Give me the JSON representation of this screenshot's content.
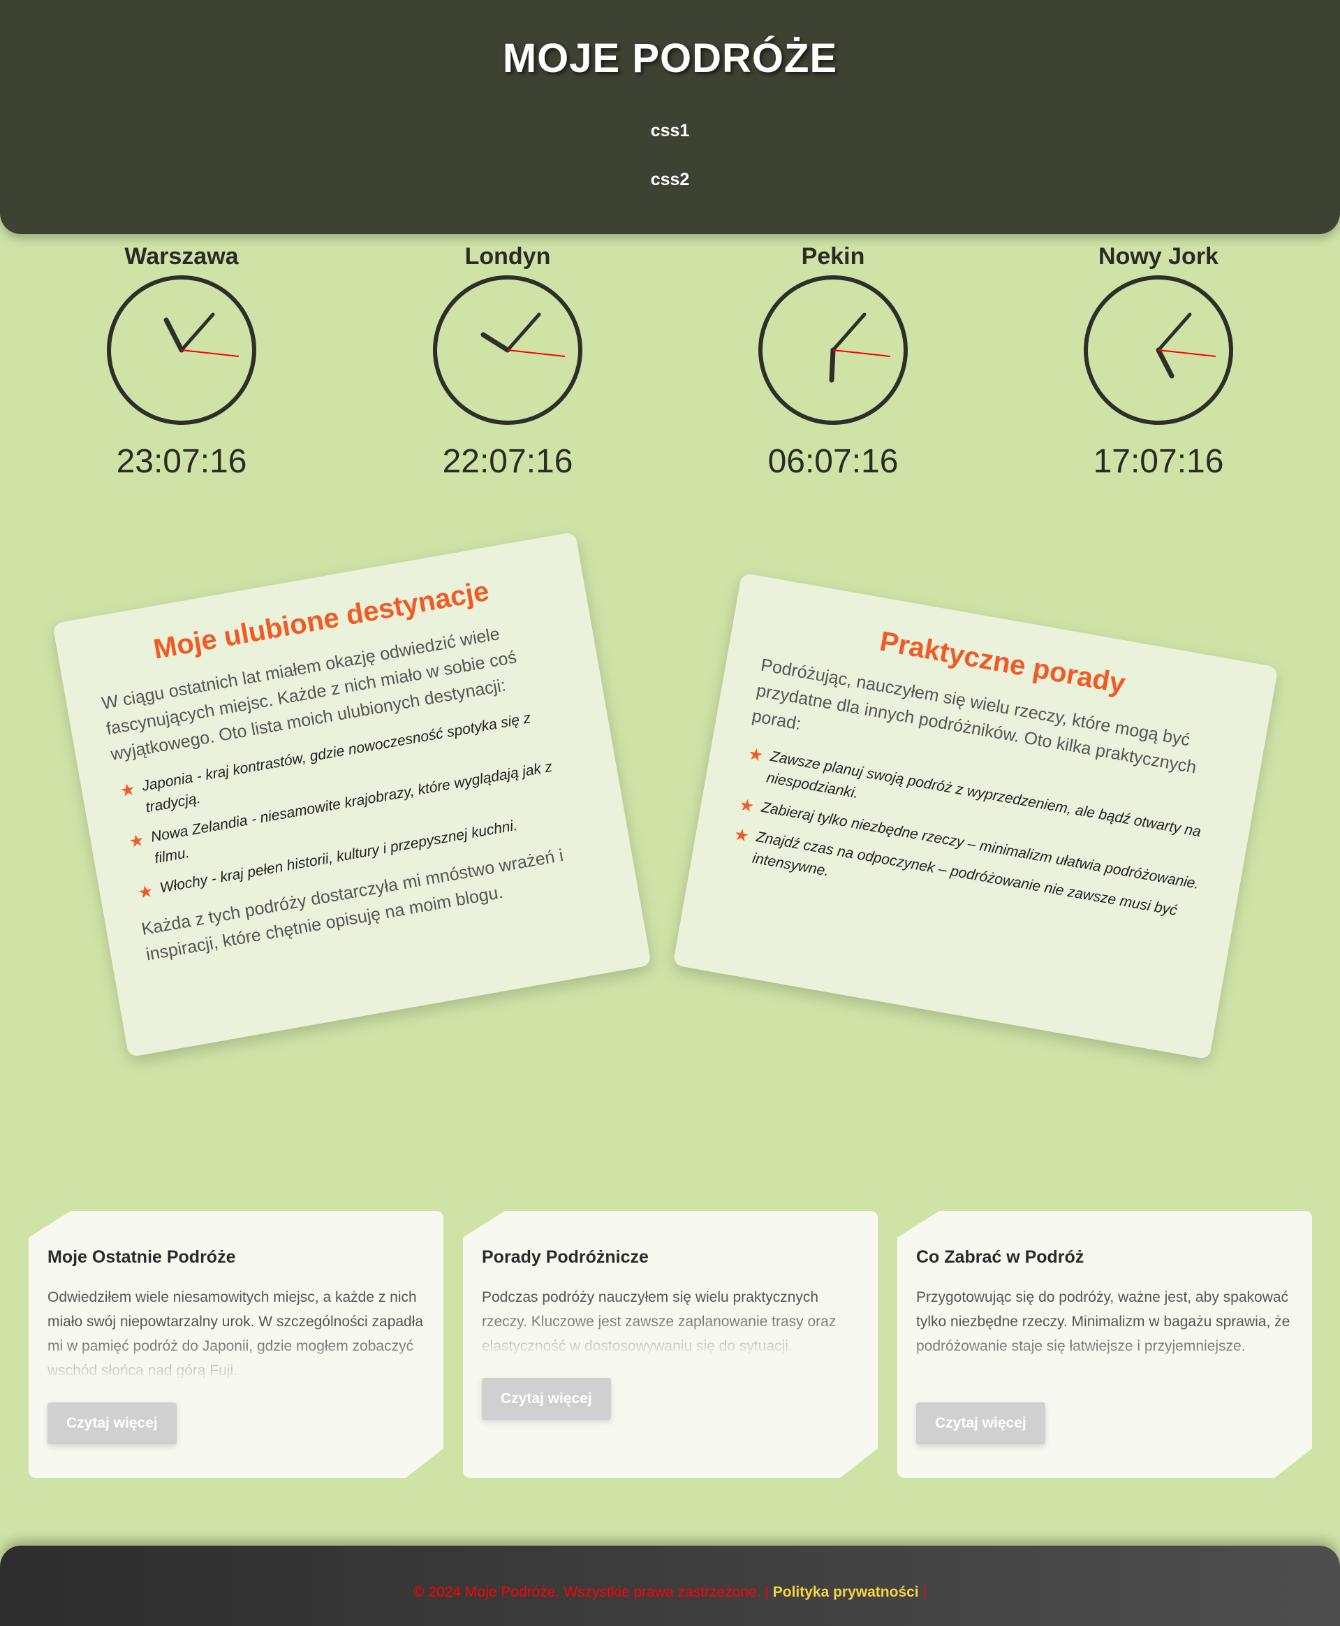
{
  "header": {
    "title": "MOJE PODRÓŻE",
    "links": [
      "css1",
      "css2"
    ]
  },
  "clocks": [
    {
      "city": "Warszawa",
      "time": "23:07:16"
    },
    {
      "city": "Londyn",
      "time": "22:07:16"
    },
    {
      "city": "Pekin",
      "time": "06:07:16"
    },
    {
      "city": "Nowy Jork",
      "time": "17:07:16"
    }
  ],
  "destinations": {
    "title": "Moje ulubione destynacje",
    "intro": "W ciągu ostatnich lat miałem okazję odwiedzić wiele fascynujących miejsc. Każde z nich miało w sobie coś wyjątkowego. Oto lista moich ulubionych destynacji:",
    "items": [
      "Japonia - kraj kontrastów, gdzie nowoczesność spotyka się z tradycją.",
      "Nowa Zelandia - niesamowite krajobrazy, które wyglądają jak z filmu.",
      "Włochy - kraj pełen historii, kultury i przepysznej kuchni."
    ],
    "outro": "Każda z tych podróży dostarczyła mi mnóstwo wrażeń i inspiracji, które chętnie opisuję na moim blogu."
  },
  "tips": {
    "title": "Praktyczne porady",
    "intro": "Podróżując, nauczyłem się wielu rzeczy, które mogą być przydatne dla innych podróżników. Oto kilka praktycznych porad:",
    "items": [
      "Zawsze planuj swoją podróż z wyprzedzeniem, ale bądź otwarty na niespodzianki.",
      "Zabieraj tylko niezbędne rzeczy – minimalizm ułatwia podróżowanie.",
      "Znajdź czas na odpoczynek – podróżowanie nie zawsze musi być intensywne."
    ]
  },
  "posts": [
    {
      "title": "Moje Ostatnie Podróże",
      "text": "Odwiedziłem wiele niesamowitych miejsc, a każde z nich miało swój niepowtarzalny urok. W szczególności zapadła mi w pamięć podróż do Japonii, gdzie mogłem zobaczyć wschód słońca nad górą Fuji.",
      "button": "Czytaj więcej"
    },
    {
      "title": "Porady Podróżnicze",
      "text": "Podczas podróży nauczyłem się wielu praktycznych rzeczy. Kluczowe jest zawsze zaplanowanie trasy oraz elastyczność w dostosowywaniu się do sytuacji.",
      "button": "Czytaj więcej"
    },
    {
      "title": "Co Zabrać w Podróż",
      "text": "Przygotowując się do podróży, ważne jest, aby spakować tylko niezbędne rzeczy. Minimalizm w bagażu sprawia, że podróżowanie staje się łatwiejsze i przyjemniejsze.",
      "button": "Czytaj więcej"
    }
  ],
  "footer": {
    "copyright": "© 2024 Moje Podróże. Wszystkie prawa zastrzeżone.",
    "separator": "|",
    "policy": "Polityka prywatności"
  },
  "colors": {
    "background": "#d0e3a7",
    "header": "#3d4232",
    "accent": "#f25a24",
    "clock_second_hand": "#ff0000"
  }
}
